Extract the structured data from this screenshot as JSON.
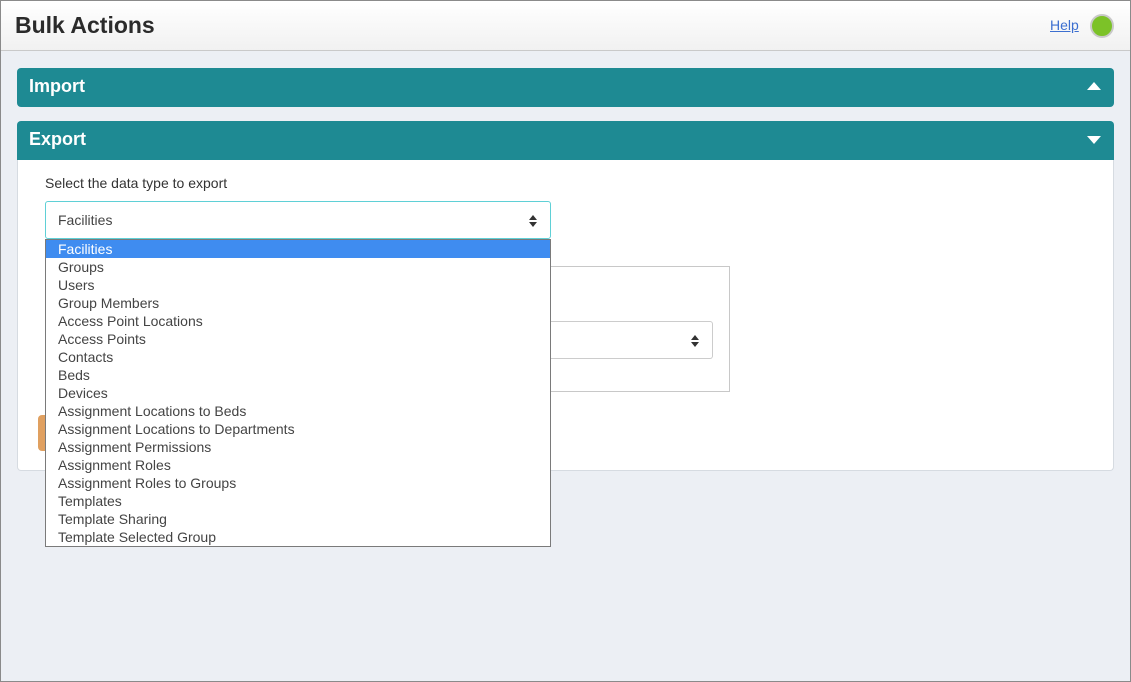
{
  "header": {
    "title": "Bulk Actions",
    "help_label": "Help",
    "status_color": "#7cc228"
  },
  "panels": {
    "import": {
      "title": "Import",
      "state_icon": "chevron-up-icon"
    },
    "export": {
      "title": "Export",
      "state_icon": "chevron-down-icon"
    }
  },
  "export": {
    "select_label": "Select the data type to export",
    "selected_value": "Facilities",
    "options": [
      "Facilities",
      "Groups",
      "Users",
      "Group Members",
      "Access Point Locations",
      "Access Points",
      "Contacts",
      "Beds",
      "Devices",
      "Assignment Locations to Beds",
      "Assignment Locations to Departments",
      "Assignment Permissions",
      "Assignment Roles",
      "Assignment Roles to Groups",
      "Templates",
      "Template Sharing",
      "Template Selected Group"
    ]
  },
  "colors": {
    "panel_header": "#1e8a93",
    "highlight": "#3f8cf0",
    "select_border": "#5fd0d6",
    "button": "#e0a060"
  }
}
